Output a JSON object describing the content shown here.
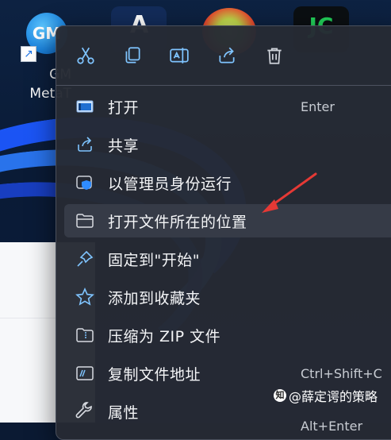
{
  "desktop": {
    "icons": [
      {
        "name": "gm-metatrader",
        "badge": "GM",
        "label_lines": [
          "GM",
          "MetaT"
        ]
      },
      {
        "name": "app-a",
        "glyph": "A"
      },
      {
        "name": "app-ball"
      },
      {
        "name": "app-jc",
        "glyph": "JC"
      }
    ]
  },
  "toolbar": {
    "actions": [
      {
        "name": "cut",
        "icon": "scissors-icon"
      },
      {
        "name": "copy",
        "icon": "copy-icon"
      },
      {
        "name": "rename",
        "icon": "rename-icon"
      },
      {
        "name": "share",
        "icon": "share-icon"
      },
      {
        "name": "delete",
        "icon": "trash-icon"
      }
    ]
  },
  "menu": {
    "items": [
      {
        "label": "打开",
        "shortcut": "Enter",
        "icon": "open-icon"
      },
      {
        "label": "共享",
        "shortcut": "",
        "icon": "share-icon"
      },
      {
        "label": "以管理员身份运行",
        "shortcut": "",
        "icon": "shield-icon"
      },
      {
        "label": "打开文件所在的位置",
        "shortcut": "",
        "icon": "folder-icon",
        "highlighted": true
      },
      {
        "label": "固定到\"开始\"",
        "shortcut": "",
        "icon": "pin-icon"
      },
      {
        "label": "添加到收藏夹",
        "shortcut": "",
        "icon": "star-icon"
      },
      {
        "label": "压缩为 ZIP 文件",
        "shortcut": "",
        "icon": "zip-icon"
      },
      {
        "label": "复制文件地址",
        "shortcut": "Ctrl+Shift+C",
        "icon": "path-icon"
      },
      {
        "label": "属性",
        "shortcut": "Alt+Enter",
        "icon": "wrench-icon"
      }
    ]
  },
  "watermark": {
    "text": "@薛定谔的策略"
  },
  "colors": {
    "menu_bg": "#262a34",
    "hover": "#363b47",
    "accent": "#4aa3ff",
    "annotation": "#e53935"
  }
}
